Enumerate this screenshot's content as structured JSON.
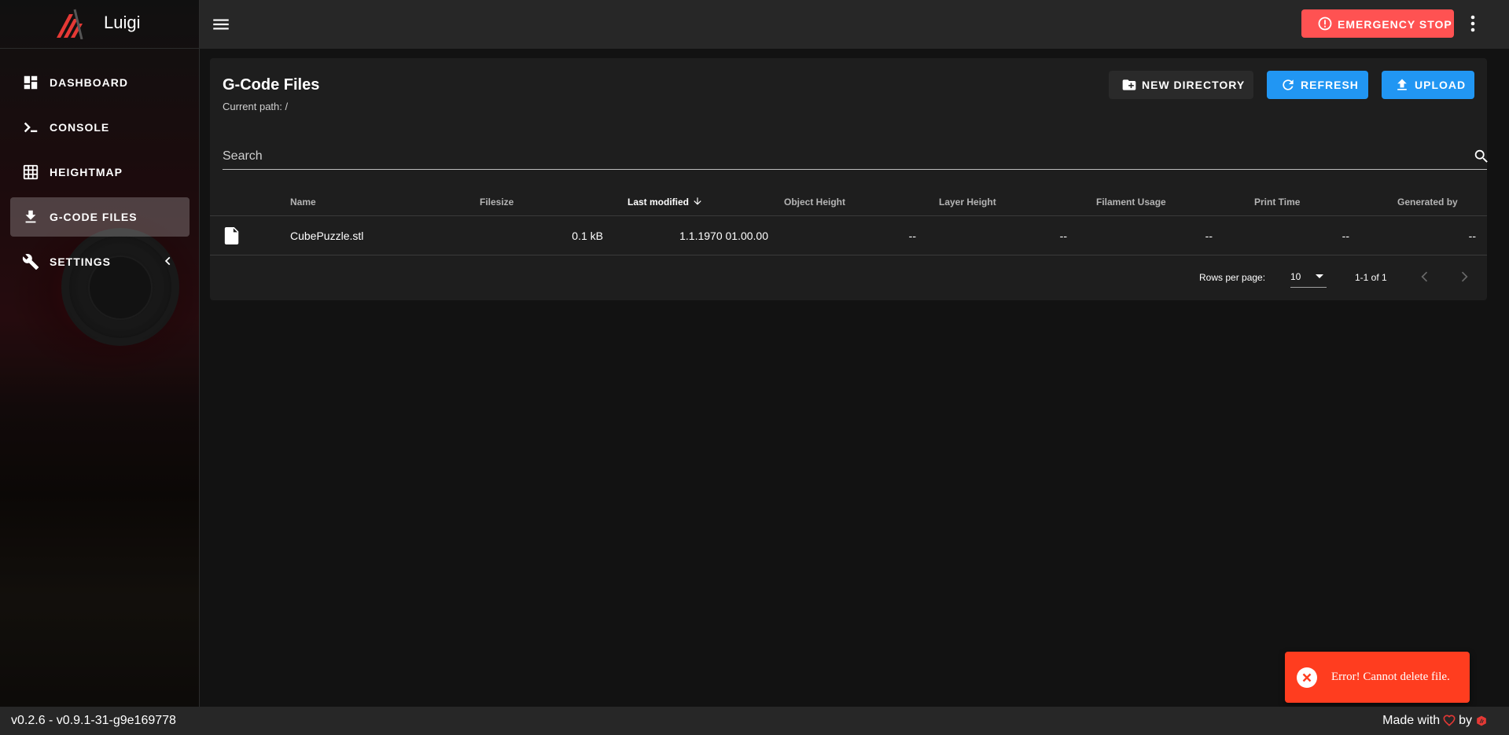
{
  "app": {
    "name": "Luigi"
  },
  "sidebar": {
    "items": [
      {
        "label": "DASHBOARD",
        "icon": "dashboard-icon"
      },
      {
        "label": "CONSOLE",
        "icon": "console-icon"
      },
      {
        "label": "HEIGHTMAP",
        "icon": "grid-icon"
      },
      {
        "label": "G-CODE FILES",
        "icon": "file-download-icon",
        "active": true
      },
      {
        "label": "SETTINGS",
        "icon": "wrench-icon"
      }
    ]
  },
  "topbar": {
    "emergency_label": "EMERGENCY STOP"
  },
  "page": {
    "title": "G-Code Files",
    "current_path": "Current path: /",
    "buttons": {
      "new_directory": "NEW DIRECTORY",
      "refresh": "REFRESH",
      "upload": "UPLOAD"
    },
    "search_placeholder": "Search"
  },
  "table": {
    "columns": [
      "Name",
      "Filesize",
      "Last modified",
      "Object Height",
      "Layer Height",
      "Filament Usage",
      "Print Time",
      "Generated by"
    ],
    "sorted_column": "Last modified",
    "rows": [
      {
        "name": "CubePuzzle.stl",
        "filesize": "0.1 kB",
        "last_modified": "1.1.1970 01.00.00",
        "object_height": "--",
        "layer_height": "--",
        "filament_usage": "--",
        "print_time": "--",
        "generated_by": "--"
      }
    ],
    "rows_per_page_label": "Rows per page:",
    "rows_per_page_value": "10",
    "range_text": "1-1 of 1"
  },
  "snackbar": {
    "message": "Error! Cannot delete file."
  },
  "footer": {
    "version": "v0.2.6 - v0.9.1-31-g9e169778",
    "made_with": "Made with",
    "by": "by"
  },
  "colors": {
    "accent": "#2196f3",
    "danger": "#ff5252",
    "snackbar": "#ff3d1f",
    "surface": "#1e1e1e",
    "bar": "#272727"
  }
}
